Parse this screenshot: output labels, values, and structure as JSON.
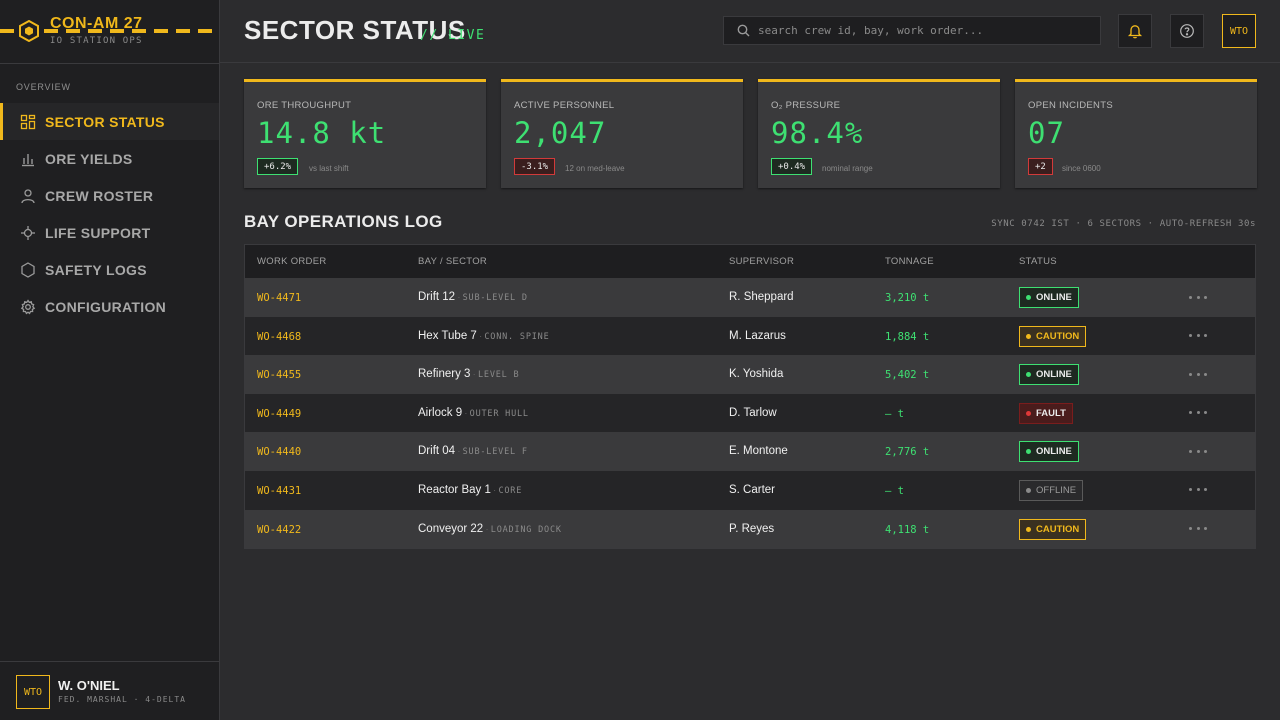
{
  "brand": {
    "name": "CON-AM 27",
    "subtitle": "IO STATION OPS",
    "icon": "hexagon-icon"
  },
  "sidebar": {
    "section": "OVERVIEW",
    "items": [
      {
        "label": "SECTOR STATUS",
        "icon": "grid-icon",
        "active": true
      },
      {
        "label": "ORE YIELDS",
        "icon": "bar-chart-icon",
        "active": false
      },
      {
        "label": "CREW ROSTER",
        "icon": "user-icon",
        "active": false
      },
      {
        "label": "LIFE SUPPORT",
        "icon": "crosshair-icon",
        "active": false
      },
      {
        "label": "SAFETY LOGS",
        "icon": "shield-icon",
        "active": false
      },
      {
        "label": "CONFIGURATION",
        "icon": "gear-icon",
        "active": false
      }
    ],
    "user": {
      "initials": "WTO",
      "name": "W. O'NIEL",
      "role": "FED. MARSHAL · 4-DELTA"
    }
  },
  "header": {
    "title": "SECTOR STATUS",
    "live": "// LIVE",
    "search_placeholder": "search crew id, bay, work order...",
    "user_initials": "WTO"
  },
  "kpis": [
    {
      "label": "ORE THROUGHPUT",
      "value": "14.8 kt",
      "delta": "+6.2%",
      "trend": "up",
      "note": "vs last shift"
    },
    {
      "label": "ACTIVE PERSONNEL",
      "value": "2,047",
      "delta": "-3.1%",
      "trend": "down",
      "note": "12 on med-leave"
    },
    {
      "label": "O₂ PRESSURE",
      "value": "98.4%",
      "delta": "+0.4%",
      "trend": "up",
      "note": "nominal range"
    },
    {
      "label": "OPEN INCIDENTS",
      "value": "07",
      "delta": "+2",
      "trend": "down",
      "note": "since 0600"
    }
  ],
  "log": {
    "title": "BAY OPERATIONS LOG",
    "meta": "SYNC 0742 IST · 6 SECTORS · AUTO-REFRESH 30s",
    "columns": [
      "WORK ORDER",
      "BAY / SECTOR",
      "SUPERVISOR",
      "TONNAGE",
      "STATUS"
    ],
    "rows": [
      {
        "wo": "WO-4471",
        "bay": "Drift 12",
        "sub": "SUB-LEVEL D",
        "supervisor": "R. Sheppard",
        "tonnage": "3,210 t",
        "status": "ONLINE",
        "kind": "online"
      },
      {
        "wo": "WO-4468",
        "bay": "Hex Tube 7",
        "sub": "CONN. SPINE",
        "supervisor": "M. Lazarus",
        "tonnage": "1,884 t",
        "status": "CAUTION",
        "kind": "caution"
      },
      {
        "wo": "WO-4455",
        "bay": "Refinery 3",
        "sub": "LEVEL B",
        "supervisor": "K. Yoshida",
        "tonnage": "5,402 t",
        "status": "ONLINE",
        "kind": "online"
      },
      {
        "wo": "WO-4449",
        "bay": "Airlock 9",
        "sub": "OUTER HULL",
        "supervisor": "D. Tarlow",
        "tonnage": "— t",
        "status": "FAULT",
        "kind": "fault"
      },
      {
        "wo": "WO-4440",
        "bay": "Drift 04",
        "sub": "SUB-LEVEL F",
        "supervisor": "E. Montone",
        "tonnage": "2,776 t",
        "status": "ONLINE",
        "kind": "online"
      },
      {
        "wo": "WO-4431",
        "bay": "Reactor Bay 1",
        "sub": "CORE",
        "supervisor": "S. Carter",
        "tonnage": "— t",
        "status": "OFFLINE",
        "kind": "offline"
      },
      {
        "wo": "WO-4422",
        "bay": "Conveyor 22",
        "sub": "LOADING DOCK",
        "supervisor": "P. Reyes",
        "tonnage": "4,118 t",
        "status": "CAUTION",
        "kind": "caution"
      }
    ]
  },
  "colors": {
    "accent": "#f0b81c",
    "ok": "#3ee072",
    "fault": "#e03838",
    "bg": "#2c2c2e",
    "panel": "#1f1f21"
  }
}
